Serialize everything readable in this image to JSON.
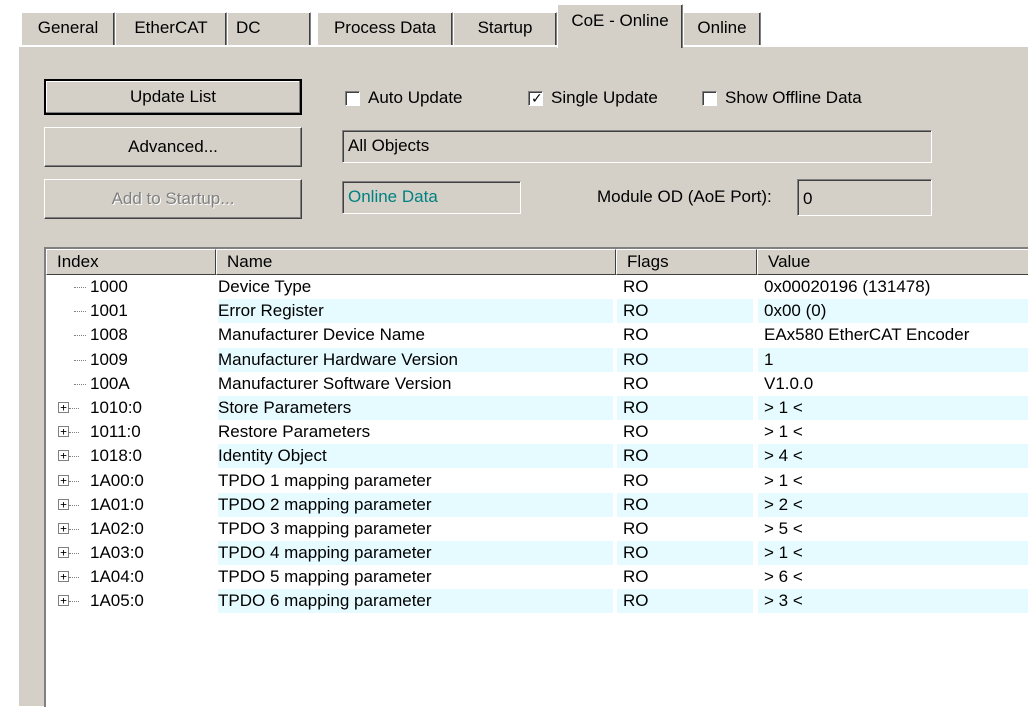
{
  "tabs": [
    {
      "label": "General"
    },
    {
      "label": "EtherCAT"
    },
    {
      "label": "DC"
    },
    {
      "label": "Process Data"
    },
    {
      "label": "Startup"
    },
    {
      "label": "CoE - Online"
    },
    {
      "label": "Online"
    }
  ],
  "active_tab": "CoE - Online",
  "buttons": {
    "update_list": "Update List",
    "advanced": "Advanced...",
    "add_to_startup": "Add to Startup..."
  },
  "options": {
    "auto_update": {
      "label": "Auto Update",
      "checked": false
    },
    "single_update": {
      "label": "Single Update",
      "checked": true
    },
    "show_offline": {
      "label": "Show Offline Data",
      "checked": false
    }
  },
  "fields": {
    "object_filter": "All Objects",
    "data_mode": "Online Data",
    "module_od_label": "Module OD (AoE Port):",
    "module_od_value": "0"
  },
  "table": {
    "columns": [
      "Index",
      "Name",
      "Flags",
      "Value"
    ],
    "rows": [
      {
        "expandable": false,
        "index": "1000",
        "name": "Device Type",
        "flags": "RO",
        "value": "0x00020196 (131478)"
      },
      {
        "expandable": false,
        "index": "1001",
        "name": "Error Register",
        "flags": "RO",
        "value": "0x00 (0)"
      },
      {
        "expandable": false,
        "index": "1008",
        "name": "Manufacturer Device Name",
        "flags": "RO",
        "value": "EAx580 EtherCAT Encoder"
      },
      {
        "expandable": false,
        "index": "1009",
        "name": "Manufacturer Hardware Version",
        "flags": "RO",
        "value": "1"
      },
      {
        "expandable": false,
        "index": "100A",
        "name": "Manufacturer Software Version",
        "flags": "RO",
        "value": "V1.0.0"
      },
      {
        "expandable": true,
        "index": "1010:0",
        "name": "Store Parameters",
        "flags": "RO",
        "value": "> 1 <"
      },
      {
        "expandable": true,
        "index": "1011:0",
        "name": "Restore Parameters",
        "flags": "RO",
        "value": "> 1 <"
      },
      {
        "expandable": true,
        "index": "1018:0",
        "name": "Identity Object",
        "flags": "RO",
        "value": "> 4 <"
      },
      {
        "expandable": true,
        "index": "1A00:0",
        "name": "TPDO 1 mapping parameter",
        "flags": "RO",
        "value": "> 1 <"
      },
      {
        "expandable": true,
        "index": "1A01:0",
        "name": "TPDO 2 mapping parameter",
        "flags": "RO",
        "value": "> 2 <"
      },
      {
        "expandable": true,
        "index": "1A02:0",
        "name": "TPDO 3 mapping parameter",
        "flags": "RO",
        "value": "> 5 <"
      },
      {
        "expandable": true,
        "index": "1A03:0",
        "name": "TPDO 4 mapping parameter",
        "flags": "RO",
        "value": "> 1 <"
      },
      {
        "expandable": true,
        "index": "1A04:0",
        "name": "TPDO 5 mapping parameter",
        "flags": "RO",
        "value": "> 6 <"
      },
      {
        "expandable": true,
        "index": "1A05:0",
        "name": "TPDO 6 mapping parameter",
        "flags": "RO",
        "value": "> 3 <"
      }
    ]
  },
  "colors": {
    "dialog_bg": "#d4d0c8",
    "alt_row": "#e6fbff",
    "online_data_text": "#008080"
  }
}
